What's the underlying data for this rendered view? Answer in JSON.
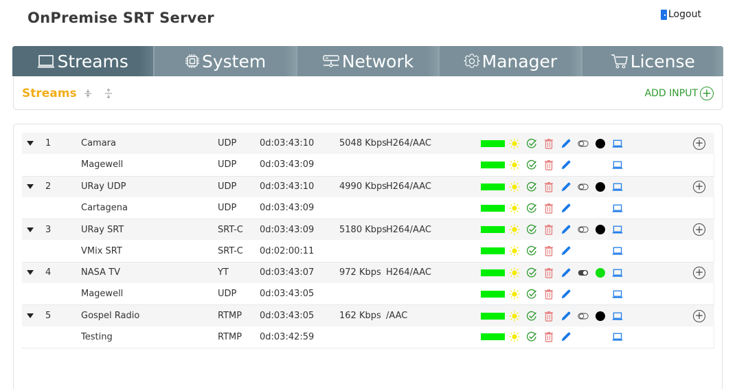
{
  "app": {
    "title": "OnPremise SRT Server",
    "logout_label": "Logout"
  },
  "nav": {
    "tabs": [
      {
        "label": "Streams",
        "icon": "laptop-icon",
        "active": true
      },
      {
        "label": "System",
        "icon": "chip-icon",
        "active": false
      },
      {
        "label": "Network",
        "icon": "network-icon",
        "active": false
      },
      {
        "label": "Manager",
        "icon": "gear-icon",
        "active": false
      },
      {
        "label": "License",
        "icon": "cart-icon",
        "active": false
      }
    ]
  },
  "subbar": {
    "title": "Streams",
    "collapse_all_icon": "collapse-all-icon",
    "expand_all_icon": "expand-all-icon",
    "add_input_label": "ADD INPUT",
    "add_input_symbol": "+"
  },
  "colors": {
    "accent_title": "#f2ae1c",
    "add_green": "#2e9a2e",
    "level_green": "#00ee00",
    "nav_active": "#536c78",
    "nav_inactive": "#7a8f99"
  },
  "streams": [
    {
      "number": "1",
      "name": "Camara",
      "protocol": "UDP",
      "uptime": "0d:03:43:10",
      "bitrate": "5048 Kbps",
      "codec": "H264/AAC",
      "toggle_on": false,
      "status_dot": "black",
      "outputs": [
        {
          "name": "Magewell",
          "protocol": "UDP",
          "uptime": "0d:03:43:09"
        }
      ]
    },
    {
      "number": "2",
      "name": "URay UDP",
      "protocol": "UDP",
      "uptime": "0d:03:43:10",
      "bitrate": "4990 Kbps",
      "codec": "H264/AAC",
      "toggle_on": false,
      "status_dot": "black",
      "outputs": [
        {
          "name": "Cartagena",
          "protocol": "UDP",
          "uptime": "0d:03:43:09"
        }
      ]
    },
    {
      "number": "3",
      "name": "URay SRT",
      "protocol": "SRT-C",
      "uptime": "0d:03:43:09",
      "bitrate": "5180 Kbps",
      "codec": "H264/AAC",
      "toggle_on": false,
      "status_dot": "black",
      "outputs": [
        {
          "name": "VMix SRT",
          "protocol": "SRT-C",
          "uptime": "0d:02:00:11"
        }
      ]
    },
    {
      "number": "4",
      "name": "NASA TV",
      "protocol": "YT",
      "uptime": "0d:03:43:07",
      "bitrate": "972 Kbps",
      "codec": "H264/AAC",
      "toggle_on": true,
      "status_dot": "green",
      "outputs": [
        {
          "name": "Magewell",
          "protocol": "UDP",
          "uptime": "0d:03:43:05"
        }
      ]
    },
    {
      "number": "5",
      "name": "Gospel Radio",
      "protocol": "RTMP",
      "uptime": "0d:03:43:05",
      "bitrate": "162 Kbps",
      "codec": "/AAC",
      "toggle_on": false,
      "status_dot": "black",
      "outputs": [
        {
          "name": "Testing",
          "protocol": "RTMP",
          "uptime": "0d:03:42:59"
        }
      ]
    }
  ],
  "row_add_symbol": "+"
}
